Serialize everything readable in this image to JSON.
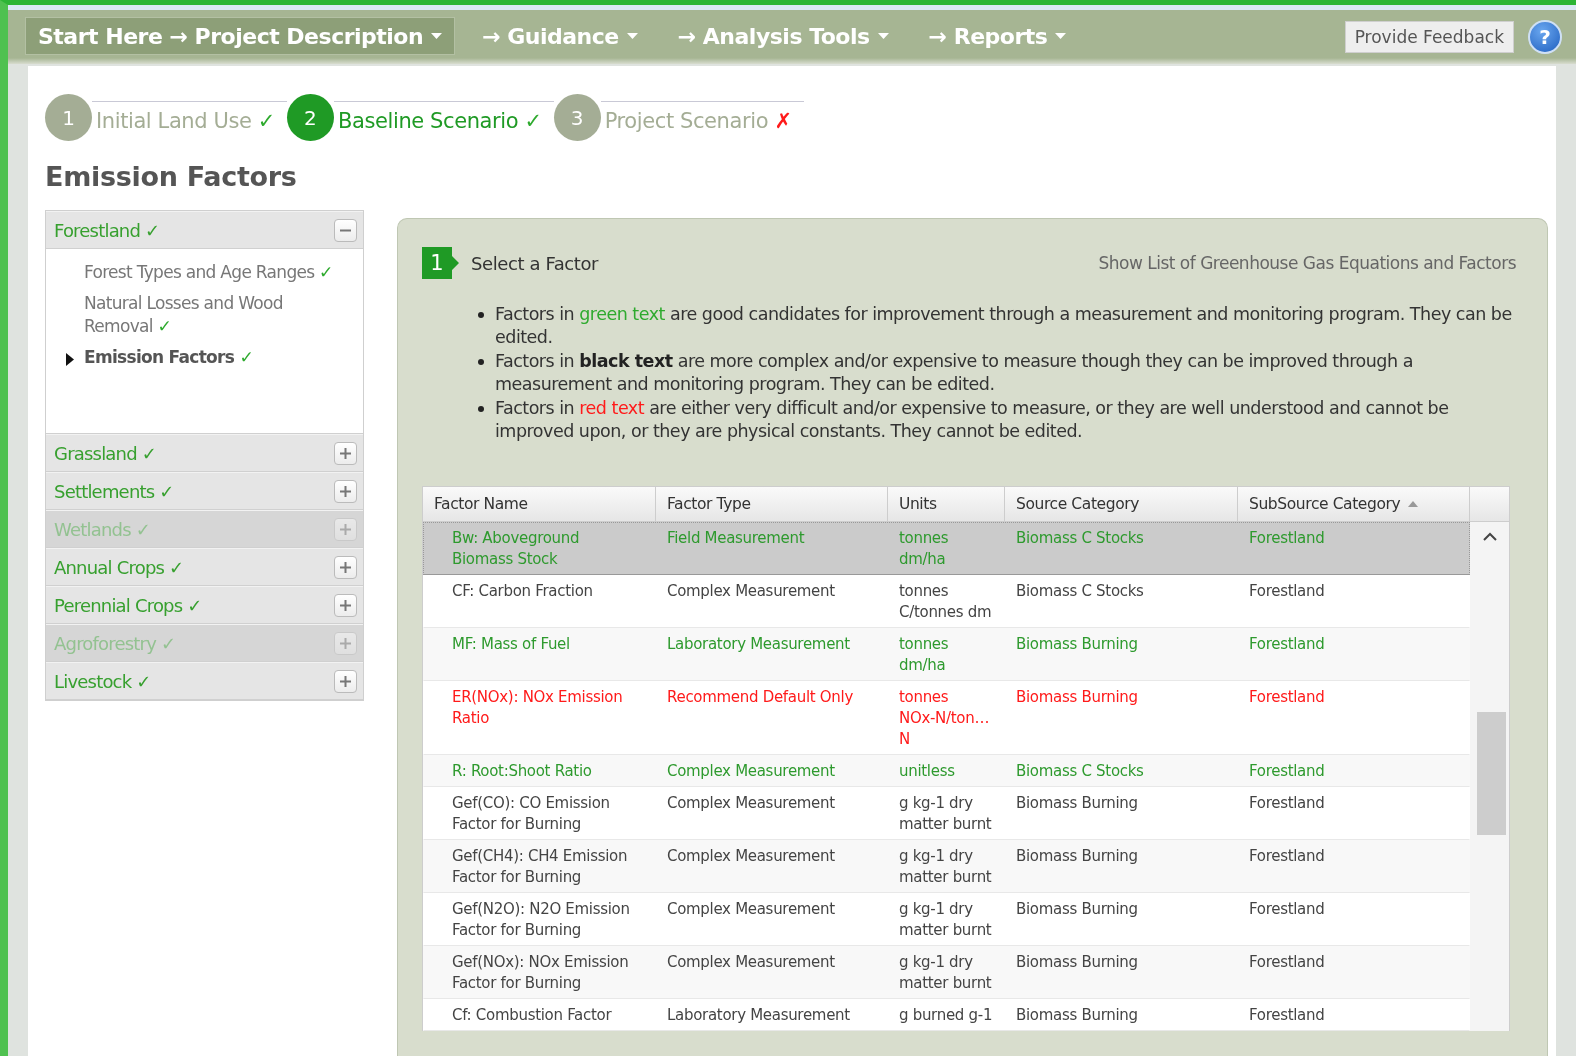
{
  "nav": {
    "items": [
      {
        "label": "Start Here → Project Description",
        "selected": true
      },
      {
        "label": "→ Guidance",
        "selected": false
      },
      {
        "label": "→ Analysis Tools",
        "selected": false
      },
      {
        "label": "→ Reports",
        "selected": false
      }
    ],
    "feedback": "Provide Feedback",
    "help": "?"
  },
  "steps": [
    {
      "number": "1",
      "label": "Initial Land Use",
      "mark": "✓",
      "complete": true,
      "selected": false
    },
    {
      "number": "2",
      "label": "Baseline Scenario",
      "mark": "✓",
      "complete": true,
      "selected": true
    },
    {
      "number": "3",
      "label": "Project Scenario",
      "mark": "✗",
      "complete": false,
      "selected": false
    }
  ],
  "title": "Emission Factors",
  "sidebar": [
    {
      "label": "Forestland",
      "mark": "✓",
      "expanded": true,
      "disabled": false,
      "children": [
        {
          "label": "Forest Types and Age Ranges",
          "mark": "✓",
          "selected": false
        },
        {
          "label": "Natural Losses and Wood Removal",
          "mark": "✓",
          "selected": false
        },
        {
          "label": "Emission Factors",
          "mark": "✓",
          "selected": true
        }
      ]
    },
    {
      "label": "Grassland",
      "mark": "✓",
      "expanded": false,
      "disabled": false
    },
    {
      "label": "Settlements",
      "mark": "✓",
      "expanded": false,
      "disabled": false
    },
    {
      "label": "Wetlands",
      "mark": "✓",
      "expanded": false,
      "disabled": true
    },
    {
      "label": "Annual Crops",
      "mark": "✓",
      "expanded": false,
      "disabled": false
    },
    {
      "label": "Perennial Crops",
      "mark": "✓",
      "expanded": false,
      "disabled": false
    },
    {
      "label": "Agroforestry",
      "mark": "✓",
      "expanded": false,
      "disabled": true
    },
    {
      "label": "Livestock",
      "mark": "✓",
      "expanded": false,
      "disabled": false
    }
  ],
  "panel": {
    "step": "1",
    "heading": "Select a Factor",
    "link": "Show List of Greenhouse Gas Equations and Factors",
    "bullets": [
      [
        {
          "kind": "plain",
          "text": "Factors in "
        },
        {
          "kind": "green",
          "text": "green text"
        },
        {
          "kind": "plain",
          "text": " are good candidates for improvement through a measurement and monitoring program. They can be edited."
        }
      ],
      [
        {
          "kind": "plain",
          "text": "Factors in "
        },
        {
          "kind": "bold",
          "text": "black text"
        },
        {
          "kind": "plain",
          "text": " are more complex and/or expensive to measure though they can be improved through a measurement and monitoring program. They can be edited."
        }
      ],
      [
        {
          "kind": "plain",
          "text": "Factors in "
        },
        {
          "kind": "red",
          "text": "red text"
        },
        {
          "kind": "plain",
          "text": " are either very difficult and/or expensive to measure, or they are well understood and cannot be improved upon, or they are physical constants. They cannot be edited."
        }
      ]
    ],
    "table": {
      "columns": [
        {
          "label": "Factor Name",
          "sorted": false
        },
        {
          "label": "Factor Type",
          "sorted": false
        },
        {
          "label": "Units",
          "sorted": false
        },
        {
          "label": "Source Category",
          "sorted": false
        },
        {
          "label": "SubSource Category",
          "sorted": true
        }
      ],
      "rows": [
        {
          "kind": "green",
          "selected": true,
          "cells": [
            "Bw: Aboveground Biomass Stock",
            "Field Measurement",
            "tonnes dm/ha",
            "Biomass C Stocks",
            "Forestland"
          ]
        },
        {
          "kind": "black",
          "selected": false,
          "cells": [
            "CF: Carbon Fraction",
            "Complex Measurement",
            "tonnes C/tonnes dm",
            "Biomass C Stocks",
            "Forestland"
          ]
        },
        {
          "kind": "green",
          "selected": false,
          "cells": [
            "MF: Mass of Fuel",
            "Laboratory Measurement",
            "tonnes dm/ha",
            "Biomass Burning",
            "Forestland"
          ]
        },
        {
          "kind": "red",
          "selected": false,
          "cells": [
            "ER(NOx): NOx Emission Ratio",
            "Recommend Default Only",
            "tonnes\nNOx-N/ton…\nN",
            "Biomass Burning",
            "Forestland"
          ]
        },
        {
          "kind": "green",
          "selected": false,
          "cells": [
            "R: Root:Shoot Ratio",
            "Complex Measurement",
            "unitless",
            "Biomass C Stocks",
            "Forestland"
          ]
        },
        {
          "kind": "black",
          "selected": false,
          "cells": [
            "Gef(CO): CO Emission Factor for Burning",
            "Complex Measurement",
            "g kg-1 dry matter burnt",
            "Biomass Burning",
            "Forestland"
          ]
        },
        {
          "kind": "black",
          "selected": false,
          "cells": [
            "Gef(CH4): CH4 Emission Factor for Burning",
            "Complex Measurement",
            "g kg-1 dry matter burnt",
            "Biomass Burning",
            "Forestland"
          ]
        },
        {
          "kind": "black",
          "selected": false,
          "cells": [
            "Gef(N2O): N2O Emission Factor for Burning",
            "Complex Measurement",
            "g kg-1 dry matter burnt",
            "Biomass Burning",
            "Forestland"
          ]
        },
        {
          "kind": "black",
          "selected": false,
          "cells": [
            "Gef(NOx): NOx Emission Factor for Burning",
            "Complex Measurement",
            "g kg-1 dry matter burnt",
            "Biomass Burning",
            "Forestland"
          ]
        },
        {
          "kind": "black",
          "selected": false,
          "cells": [
            "Cf: Combustion Factor",
            "Laboratory Measurement",
            "g burned g-1",
            "Biomass Burning",
            "Forestland"
          ]
        }
      ]
    }
  }
}
